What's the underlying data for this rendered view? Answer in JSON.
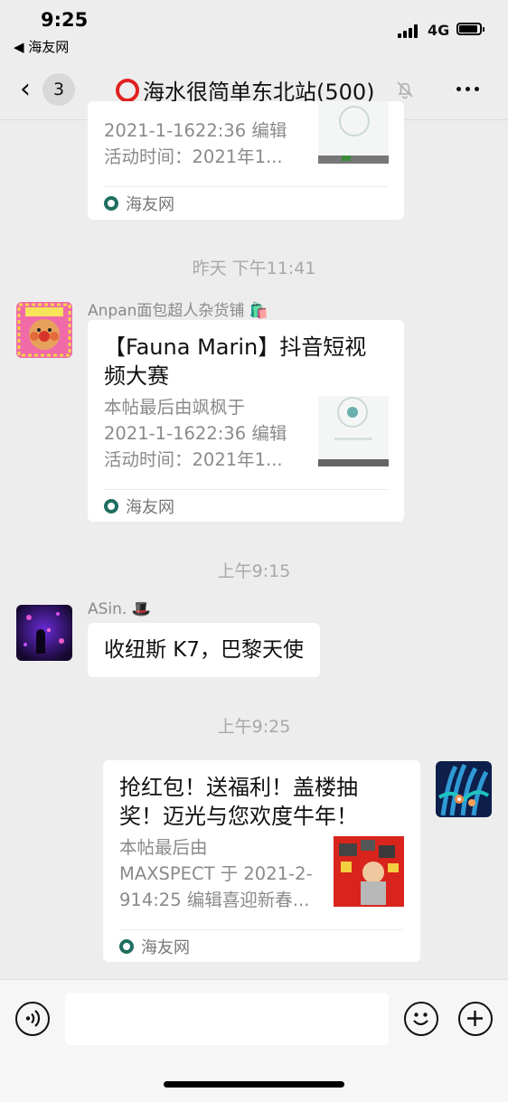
{
  "status_bar": {
    "time": "9:25",
    "back_app": "◀ 海友网",
    "network": "4G"
  },
  "nav": {
    "back_count": "3",
    "title": "海水很简单东北站(500)"
  },
  "messages": [
    {
      "type": "card_partial",
      "desc_line1": "2021-1-1622:36 编辑",
      "desc_line2": "活动时间：2021年1...",
      "footer": "海友网"
    },
    {
      "type": "timestamp",
      "text": "昨天 下午11:41"
    },
    {
      "type": "card",
      "sender": "Anpan面包超人杂货铺",
      "sender_emoji": "🛍️",
      "title": "【Fauna Marin】抖音短视频大赛",
      "title_line1": "【Fauna Marin】抖音短视",
      "title_line2": "频大赛",
      "desc_line1": "本帖最后由飒枫于",
      "desc_line2": "2021-1-1622:36 编辑",
      "desc_line3": "活动时间：2021年1...",
      "footer": "海友网"
    },
    {
      "type": "timestamp",
      "text": "上午9:15"
    },
    {
      "type": "text",
      "sender": "ASin.",
      "sender_emoji": "🎩",
      "text": "收纽斯 K7，巴黎天使"
    },
    {
      "type": "timestamp",
      "text": "上午9:25"
    },
    {
      "type": "card_self",
      "title_line1": "抢红包！送福利！盖楼抽",
      "title_line2": "奖！迈光与您欢度牛年！",
      "desc_line1": "本帖最后由",
      "desc_line2": "MAXSPECT 于 2021-2-",
      "desc_line3": "914:25 编辑喜迎新春...",
      "footer": "海友网"
    }
  ],
  "input": {
    "placeholder": ""
  },
  "icons": {
    "voice": "voice-icon",
    "emoji": "emoji-icon",
    "plus": "plus-icon",
    "mute": "mute-bell-icon",
    "more": "more-icon"
  },
  "colors": {
    "background": "#ededed",
    "bubble": "#ffffff",
    "accent_red": "#e02020",
    "meta_gray": "#a8a8a8"
  }
}
